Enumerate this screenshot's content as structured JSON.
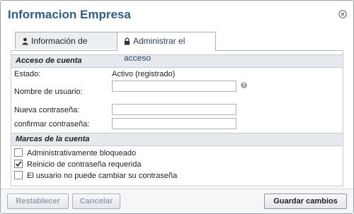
{
  "dialog": {
    "title": "Informacion Empresa",
    "close_icon": "close-circle-icon"
  },
  "tabs": [
    {
      "label": "Información de usuario",
      "icon": "user-icon",
      "active": false
    },
    {
      "label": "Administrar el acceso",
      "icon": "lock-icon",
      "active": true
    }
  ],
  "access": {
    "section_title": "Acceso de cuenta",
    "status_label": "Estado:",
    "status_value": "Activo (registrado)",
    "username_label": "Nombre de usuario:",
    "username_value": "",
    "new_password_label": "Nueva contraseña:",
    "new_password_value": "",
    "confirm_password_label": "confirmar contraseña:",
    "confirm_password_value": ""
  },
  "flags": {
    "section_title": "Marcas de la cuenta",
    "items": [
      {
        "label": "Administrativamente bloqueado",
        "checked": false
      },
      {
        "label": "Reinicio de contraseña requerida",
        "checked": true
      },
      {
        "label": "El usuario no puede cambiar su contraseña",
        "checked": false
      }
    ]
  },
  "footer": {
    "reset_label": "Restablecer",
    "cancel_label": "Cancelar",
    "save_label": "Guardar cambios"
  },
  "colors": {
    "title": "#2c5f8a",
    "section_bg": "#e6eaee"
  }
}
